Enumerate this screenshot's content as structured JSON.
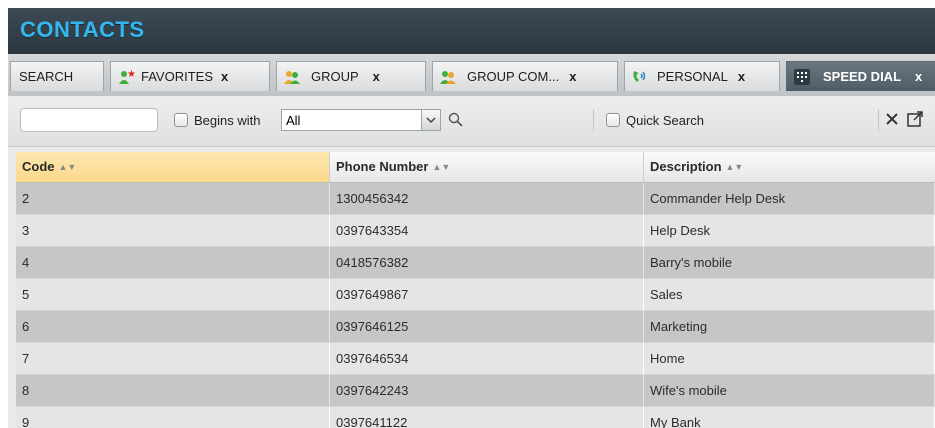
{
  "app": {
    "title": "CONTACTS"
  },
  "tabs": [
    {
      "label": "SEARCH",
      "close": "",
      "icon": ""
    },
    {
      "label": "FAVORITES",
      "close": "x",
      "icon": "favorites-icon"
    },
    {
      "label": "GROUP",
      "close": "x",
      "icon": "group-icon"
    },
    {
      "label": "GROUP COM...",
      "close": "x",
      "icon": "group-common-icon"
    },
    {
      "label": "PERSONAL",
      "close": "x",
      "icon": "personal-icon"
    },
    {
      "label": "SPEED DIAL",
      "close": "x",
      "icon": "speed-dial-icon",
      "active": true
    }
  ],
  "toolbar": {
    "search_value": "",
    "begins_with_label": "Begins with",
    "filter_selected": "All",
    "quick_search_label": "Quick Search"
  },
  "table": {
    "headers": [
      "Code",
      "Phone Number",
      "Description"
    ],
    "sorted_column": "Code",
    "rows": [
      [
        "2",
        "1300456342",
        "Commander Help Desk"
      ],
      [
        "3",
        "0397643354",
        "Help Desk"
      ],
      [
        "4",
        "0418576382",
        "Barry's mobile"
      ],
      [
        "5",
        "0397649867",
        "Sales"
      ],
      [
        "6",
        "0397646125",
        "Marketing"
      ],
      [
        "7",
        "0397646534",
        "Home"
      ],
      [
        "8",
        "0397642243",
        "Wife's mobile"
      ],
      [
        "9",
        "0397641122",
        "My Bank"
      ]
    ]
  },
  "colors": {
    "title": "#34b7ee",
    "titlebar": "#36434d",
    "sorted_header": "#fbd98a",
    "active_tab": "#5a6770"
  }
}
